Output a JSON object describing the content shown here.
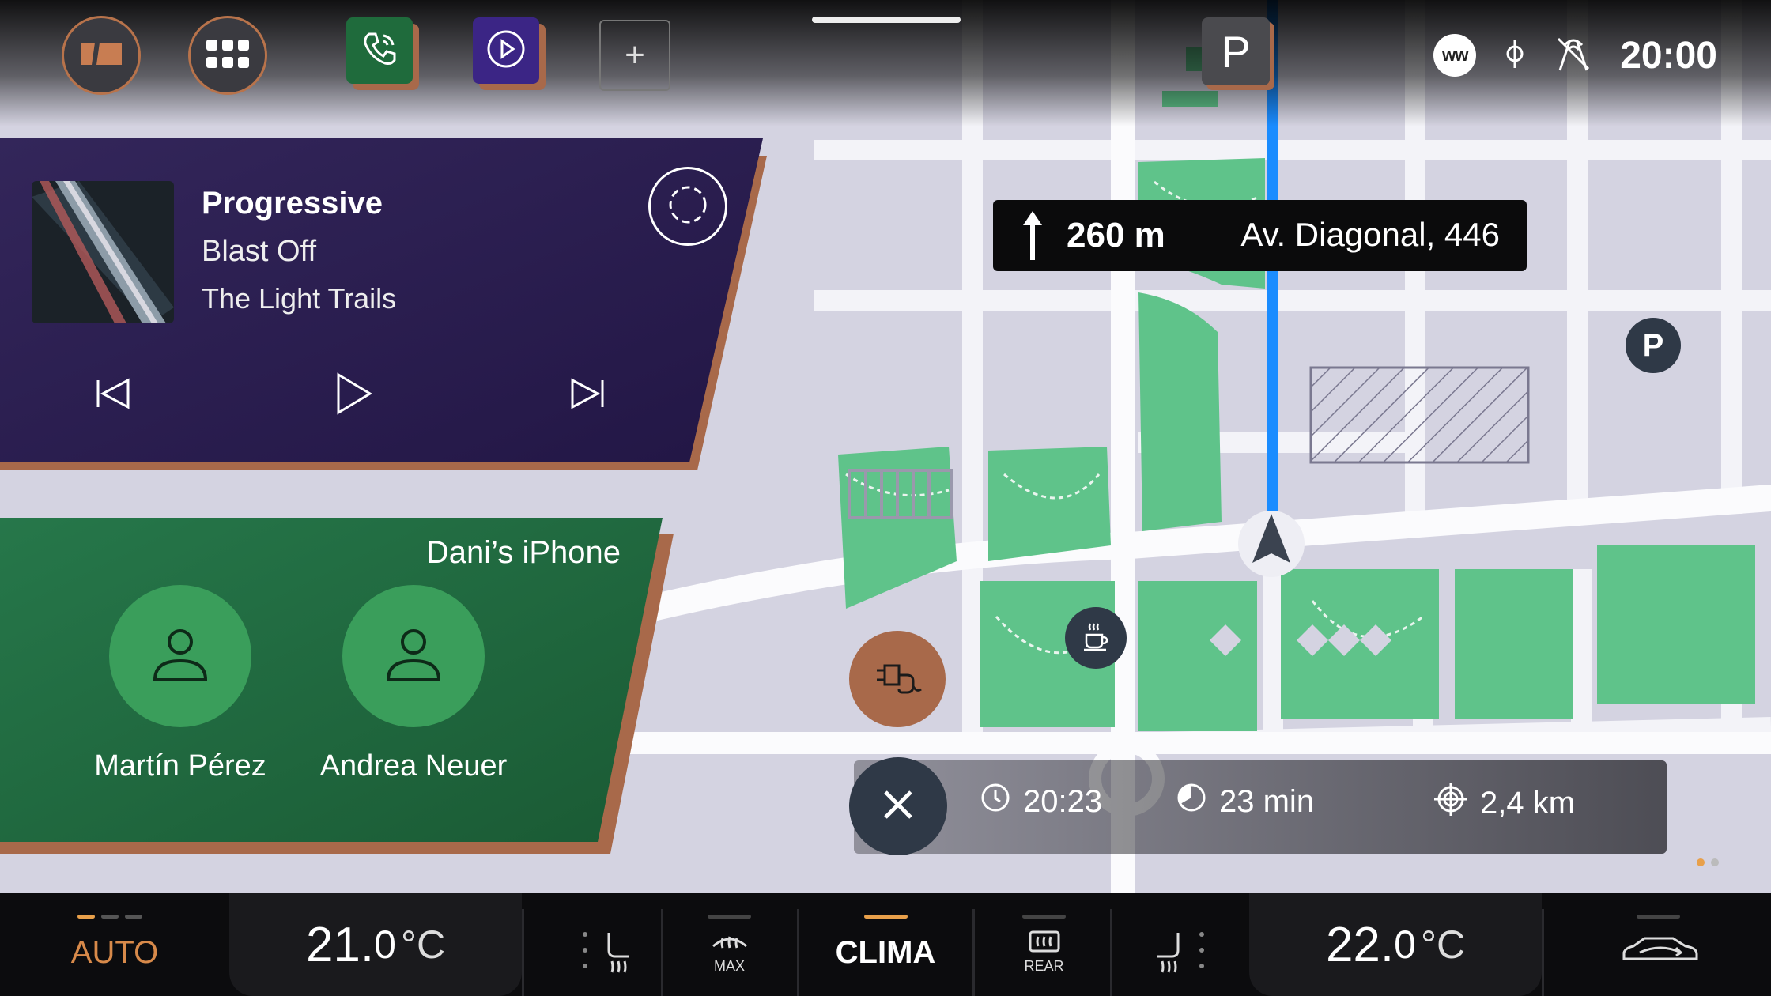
{
  "status": {
    "badge": "ww",
    "clock": "20:00"
  },
  "map": {
    "parking_tile": "P",
    "parking_poi": "P",
    "route_color": "#1a8cff",
    "park_color": "#5fc38a"
  },
  "navigation": {
    "distance": "260 m",
    "street": "Av. Diagonal, 446",
    "eta": "20:23",
    "duration": "23 min",
    "remaining": "2,4 km"
  },
  "media": {
    "title": "Progressive",
    "artist": "Blast Off",
    "album": "The Light Trails"
  },
  "phone": {
    "device": "Dani’s iPhone",
    "contacts": [
      {
        "name": "Martín Pérez"
      },
      {
        "name": "Andrea Neuer"
      }
    ]
  },
  "climate": {
    "auto_label": "AUTO",
    "left_temp_int": "21.",
    "left_temp_dec": "0",
    "right_temp_int": "22.",
    "right_temp_dec": "0",
    "unit": "°C",
    "max_label": "MAX",
    "clima_label": "CLIMA",
    "rear_label": "REAR",
    "accent": "#e8a04a"
  },
  "colors": {
    "media_card": "#2c2150",
    "phone_card": "#20683c",
    "copper": "#a8694a"
  },
  "icons": [
    "tiles-icon",
    "grid-icon",
    "phone-icon",
    "play-circle-icon",
    "plus-icon",
    "wireless-charging-icon",
    "lane-assist-icon",
    "sync-icon",
    "skip-previous-icon",
    "play-icon",
    "skip-next-icon",
    "person-icon",
    "arrow-up-icon",
    "close-icon",
    "charging-plug-icon",
    "coffee-icon",
    "clock-icon",
    "pie-icon",
    "target-icon",
    "seat-heat-icon",
    "defrost-max-icon",
    "rear-defrost-icon",
    "car-icon"
  ]
}
